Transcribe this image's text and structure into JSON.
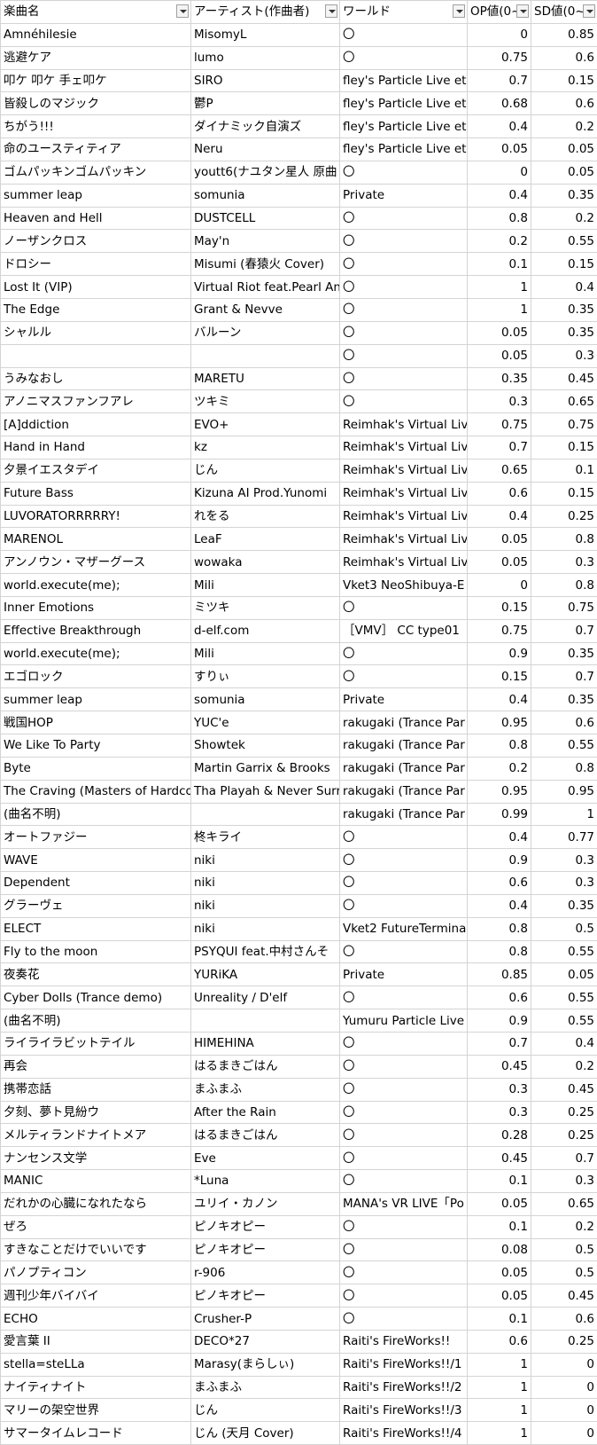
{
  "headers": [
    "楽曲名",
    "アーティスト(作曲者)",
    "ワールド",
    "OP値(0~",
    "SD値(0~"
  ],
  "filter_icon": "dropdown-arrow",
  "rows": [
    [
      "Amnéhilesie",
      "MisomyL",
      "〇",
      "0",
      "0.85"
    ],
    [
      "逃避ケア",
      "lumo",
      "〇",
      "0.75",
      "0.6"
    ],
    [
      "叩ケ 叩ケ 手ェ叩ケ",
      "SIRO",
      "fley's Particle Live et",
      "0.7",
      "0.15"
    ],
    [
      "皆殺しのマジック",
      "鬱P",
      "fley's Particle Live et",
      "0.68",
      "0.6"
    ],
    [
      "ちがう!!!",
      "ダイナミック自演ズ",
      "fley's Particle Live et",
      "0.4",
      "0.2"
    ],
    [
      "命のユースティティア",
      "Neru",
      "fley's Particle Live et",
      "0.05",
      "0.05"
    ],
    [
      "ゴムパッキンゴムパッキン",
      "youtt6(ナユタン星人 原曲",
      "〇",
      "0",
      "0.05"
    ],
    [
      "summer leap",
      "somunia",
      "Private",
      "0.4",
      "0.35"
    ],
    [
      "Heaven and Hell",
      "DUSTCELL",
      "〇",
      "0.8",
      "0.2"
    ],
    [
      "ノーザンクロス",
      "May'n",
      "〇",
      "0.2",
      "0.55"
    ],
    [
      "ドロシー",
      "Misumi (春猿火 Cover)",
      "〇",
      "0.1",
      "0.15"
    ],
    [
      "Lost It (VIP)",
      "Virtual Riot feat.Pearl An",
      "〇",
      "1",
      "0.4"
    ],
    [
      "The Edge",
      "Grant & Nevve",
      "〇",
      "1",
      "0.35"
    ],
    [
      "シャルル",
      "バルーン",
      "〇",
      "0.05",
      "0.35"
    ],
    [
      "",
      "",
      "〇",
      "0.05",
      "0.3"
    ],
    [
      "うみなおし",
      "MARETU",
      "〇",
      "0.35",
      "0.45"
    ],
    [
      "アノニマスファンフアレ",
      "ツキミ",
      "〇",
      "0.3",
      "0.65"
    ],
    [
      "[A]ddiction",
      "EVO+",
      "Reimhak's Virtual Liv",
      "0.75",
      "0.75"
    ],
    [
      "Hand in Hand",
      "kz",
      "Reimhak's Virtual Liv",
      "0.7",
      "0.15"
    ],
    [
      "夕景イエスタデイ",
      "じん",
      "Reimhak's Virtual Liv",
      "0.65",
      "0.1"
    ],
    [
      "Future Bass",
      "Kizuna AI Prod.Yunomi",
      "Reimhak's Virtual Liv",
      "0.6",
      "0.15"
    ],
    [
      "LUVORATORRRRRY!",
      "れをる",
      "Reimhak's Virtual Liv",
      "0.4",
      "0.25"
    ],
    [
      "MARENOL",
      "LeaF",
      "Reimhak's Virtual Liv",
      "0.05",
      "0.8"
    ],
    [
      "アンノウン・マザーグース",
      "wowaka",
      "Reimhak's Virtual Liv",
      "0.05",
      "0.3"
    ],
    [
      "world.execute(me);",
      "Mili",
      "Vket3 NeoShibuya-E",
      "0",
      "0.8"
    ],
    [
      "Inner Emotions",
      "ミツキ",
      "〇",
      "0.15",
      "0.75"
    ],
    [
      "Effective Breakthrough",
      "d-elf.com",
      "［VMV］ CC type01",
      "0.75",
      "0.7"
    ],
    [
      "world.execute(me);",
      "Mili",
      "〇",
      "0.9",
      "0.35"
    ],
    [
      "エゴロック",
      "すりぃ",
      "〇",
      "0.15",
      "0.7"
    ],
    [
      "summer leap",
      "somunia",
      "Private",
      "0.4",
      "0.35"
    ],
    [
      "戦国HOP",
      "YUC'e",
      "rakugaki (Trance Par",
      "0.95",
      "0.6"
    ],
    [
      "We Like To Party",
      "Showtek",
      "rakugaki (Trance Par",
      "0.8",
      "0.55"
    ],
    [
      "Byte",
      "Martin Garrix & Brooks",
      "rakugaki (Trance Par",
      "0.2",
      "0.8"
    ],
    [
      "The Craving (Masters of Hardco",
      "Tha Playah & Never Surr",
      "rakugaki (Trance Par",
      "0.95",
      "0.95"
    ],
    [
      "(曲名不明)",
      "",
      "rakugaki (Trance Par",
      "0.99",
      "1"
    ],
    [
      "オートファジー",
      "柊キライ",
      "〇",
      "0.4",
      "0.77"
    ],
    [
      "WAVE",
      "niki",
      "〇",
      "0.9",
      "0.3"
    ],
    [
      "Dependent",
      "niki",
      "〇",
      "0.6",
      "0.3"
    ],
    [
      "グラーヴェ",
      "niki",
      "〇",
      "0.4",
      "0.35"
    ],
    [
      "ELECT",
      "niki",
      "Vket2 FutureTermina",
      "0.8",
      "0.5"
    ],
    [
      "Fly to the moon",
      "PSYQUI feat.中村さんそ",
      "〇",
      "0.8",
      "0.55"
    ],
    [
      "夜奏花",
      "YURiKA",
      "Private",
      "0.85",
      "0.05"
    ],
    [
      "Cyber Dolls (Trance demo)",
      "Unreality / D'elf",
      "〇",
      "0.6",
      "0.55"
    ],
    [
      "(曲名不明)",
      "",
      "Yumuru Particle Live",
      "0.9",
      "0.55"
    ],
    [
      "ライライラビットテイル",
      "HIMEHINA",
      "〇",
      "0.7",
      "0.4"
    ],
    [
      "再会",
      "はるまきごはん",
      "〇",
      "0.45",
      "0.2"
    ],
    [
      "携帯恋話",
      "まふまふ",
      "〇",
      "0.3",
      "0.45"
    ],
    [
      "夕刻、夢ト見紛ウ",
      "After the Rain",
      "〇",
      "0.3",
      "0.25"
    ],
    [
      "メルティランドナイトメア",
      "はるまきごはん",
      "〇",
      "0.28",
      "0.25"
    ],
    [
      "ナンセンス文学",
      "Eve",
      "〇",
      "0.45",
      "0.7"
    ],
    [
      "MANIC",
      "*Luna",
      "〇",
      "0.1",
      "0.3"
    ],
    [
      "だれかの心臓になれたなら",
      "ユリイ・カノン",
      "MANA's VR LIVE「Po",
      "0.05",
      "0.65"
    ],
    [
      "ぜろ",
      "ピノキオピー",
      "〇",
      "0.1",
      "0.2"
    ],
    [
      "すきなことだけでいいです",
      "ピノキオピー",
      "〇",
      "0.08",
      "0.5"
    ],
    [
      "パノプティコン",
      "r-906",
      "〇",
      "0.05",
      "0.5"
    ],
    [
      "週刊少年バイバイ",
      "ピノキオピー",
      "〇",
      "0.05",
      "0.45"
    ],
    [
      "ECHO",
      "Crusher-P",
      "〇",
      "0.1",
      "0.6"
    ],
    [
      "愛言葉 II",
      "DECO*27",
      "Raiti's FireWorks!!",
      "0.6",
      "0.25"
    ],
    [
      "stella=steLLa",
      "Marasy(まらしぃ)",
      "Raiti's FireWorks!!/1",
      "1",
      "0"
    ],
    [
      "ナイティナイト",
      "まふまふ",
      "Raiti's FireWorks!!/2",
      "1",
      "0"
    ],
    [
      "マリーの架空世界",
      "じん",
      "Raiti's FireWorks!!/3",
      "1",
      "0"
    ],
    [
      "サマータイムレコード",
      "じん (天月 Cover)",
      "Raiti's FireWorks!!/4",
      "1",
      "0"
    ]
  ]
}
